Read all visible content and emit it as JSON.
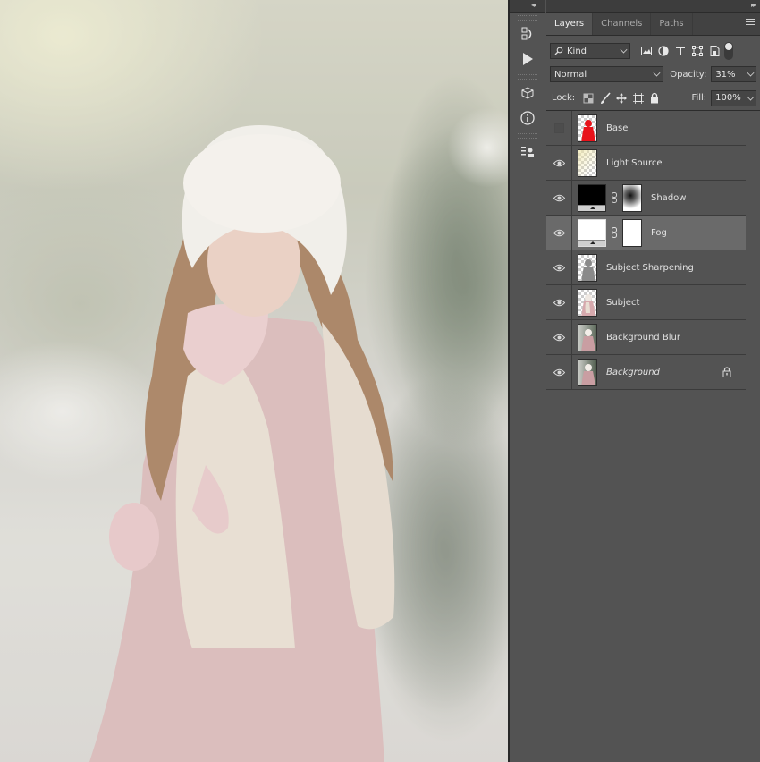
{
  "panel": {
    "tabs": [
      {
        "label": "Layers",
        "active": true
      },
      {
        "label": "Channels",
        "active": false
      },
      {
        "label": "Paths",
        "active": false
      }
    ],
    "filter": {
      "kind_label": "Kind"
    },
    "blend_mode": "Normal",
    "opacity_label": "Opacity:",
    "opacity_value": "31%",
    "lock_label": "Lock:",
    "fill_label": "Fill:",
    "fill_value": "100%",
    "layers": [
      {
        "name": "Base",
        "visible": false,
        "thumb": "red-silhouette"
      },
      {
        "name": "Light Source",
        "visible": true,
        "thumb": "light-source"
      },
      {
        "name": "Shadow",
        "visible": true,
        "thumb": "black-fill",
        "mask": "radial-mask"
      },
      {
        "name": "Fog",
        "visible": true,
        "thumb": "white-fill",
        "mask": "white-mask",
        "selected": true
      },
      {
        "name": "Subject Sharpening",
        "visible": true,
        "thumb": "gray-silhouette"
      },
      {
        "name": "Subject",
        "visible": true,
        "thumb": "subject-cutout"
      },
      {
        "name": "Background Blur",
        "visible": true,
        "thumb": "photo"
      },
      {
        "name": "Background",
        "visible": true,
        "thumb": "photo",
        "locked": true,
        "italic": true
      }
    ]
  },
  "colors": {
    "panel_bg": "#535353",
    "selected_layer": "#6a6a6a",
    "base_thumb_red": "#e8121a"
  }
}
